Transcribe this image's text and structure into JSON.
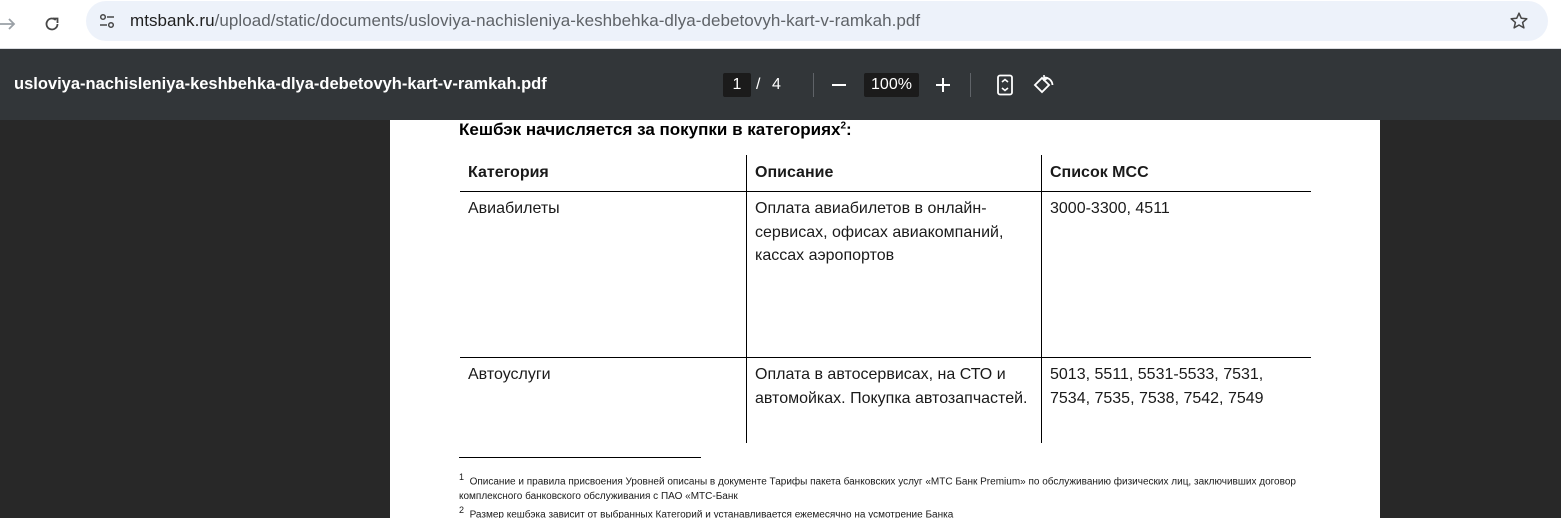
{
  "browser": {
    "url_domain": "mtsbank.ru",
    "url_path": "/upload/static/documents/usloviya-nachisleniya-keshbehka-dlya-debetovyh-kart-v-ramkah.pdf",
    "icons": [
      "arrow-forward-icon",
      "reload-icon",
      "site-info-icon",
      "bookmark-star-icon"
    ]
  },
  "pdf_toolbar": {
    "title": "usloviya-nachisleniya-keshbehka-dlya-debetovyh-kart-v-ramkah.pdf",
    "page_current": "1",
    "page_sep": "/",
    "page_total": "4",
    "zoom": "100%",
    "icons": [
      "zoom-out-icon",
      "zoom-in-icon",
      "fit-page-icon",
      "rotate-icon"
    ]
  },
  "document": {
    "heading": "Кешбэк начисляется за покупки в категориях",
    "heading_sup": "2",
    "heading_tail": ":",
    "table": {
      "headers": [
        "Категория",
        "Описание",
        "Список МСС"
      ],
      "rows": [
        [
          "Авиабилеты",
          "Оплата авиабилетов в онлайн-сервисах, офисах авиакомпаний, кассах аэропортов",
          "3000-3300, 4511"
        ],
        [
          "Автоуслуги",
          "Оплата в автосервисах, на СТО и автомойках. Покупка автозапчастей.",
          "5013, 5511, 5531-5533, 7531, 7534, 7535, 7538, 7542, 7549"
        ]
      ]
    },
    "footnotes": [
      {
        "num": "1",
        "text": "Описание и правила присвоения Уровней описаны в документе Тарифы пакета банковских услуг «МТС Банк Premium» по обслуживанию физических лиц, заключивших договор комплексного банковского обслуживания с ПАО «МТС-Банк"
      },
      {
        "num": "2",
        "text": "Размер кешбэка зависит от выбранных Категорий и устанавливается ежемесячно на усмотрение Банка"
      }
    ]
  }
}
